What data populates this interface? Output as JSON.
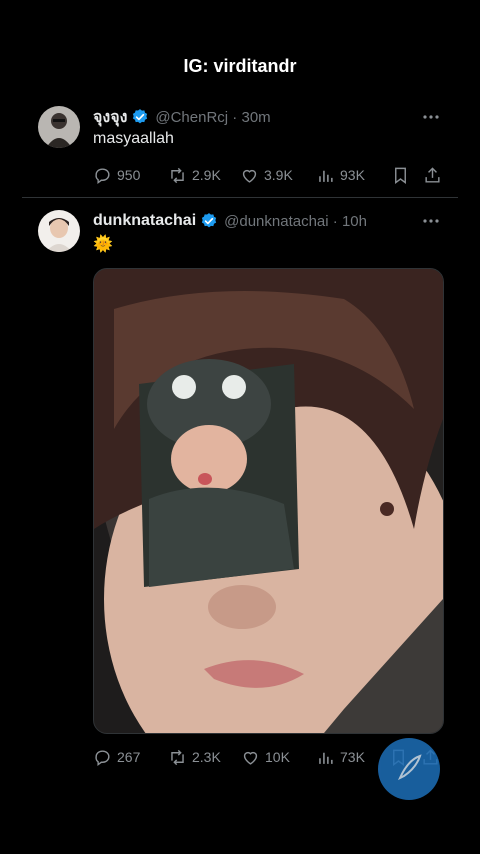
{
  "watermark": "IG: virditandr",
  "tweets": [
    {
      "display_name": "จุงจุง",
      "handle": "@ChenRcj",
      "time": "30m",
      "text": "masyaallah",
      "replies": "950",
      "retweets": "2.9K",
      "likes": "3.9K",
      "views": "93K"
    },
    {
      "display_name": "dunknatachai",
      "handle": "@dunknatachai",
      "time": "10h",
      "text": "🌞",
      "replies": "267",
      "retweets": "2.3K",
      "likes": "10K",
      "views": "73K"
    }
  ],
  "icons": {
    "verified": "verified-badge-icon",
    "more": "more-horizontal-icon",
    "reply": "reply-icon",
    "retweet": "retweet-icon",
    "like": "heart-icon",
    "views": "views-bar-icon",
    "bookmark": "bookmark-icon",
    "share": "share-icon"
  },
  "colors": {
    "background": "#000000",
    "verified": "#1d9bf0",
    "muted": "#71767b",
    "text": "#e7e9ea"
  }
}
